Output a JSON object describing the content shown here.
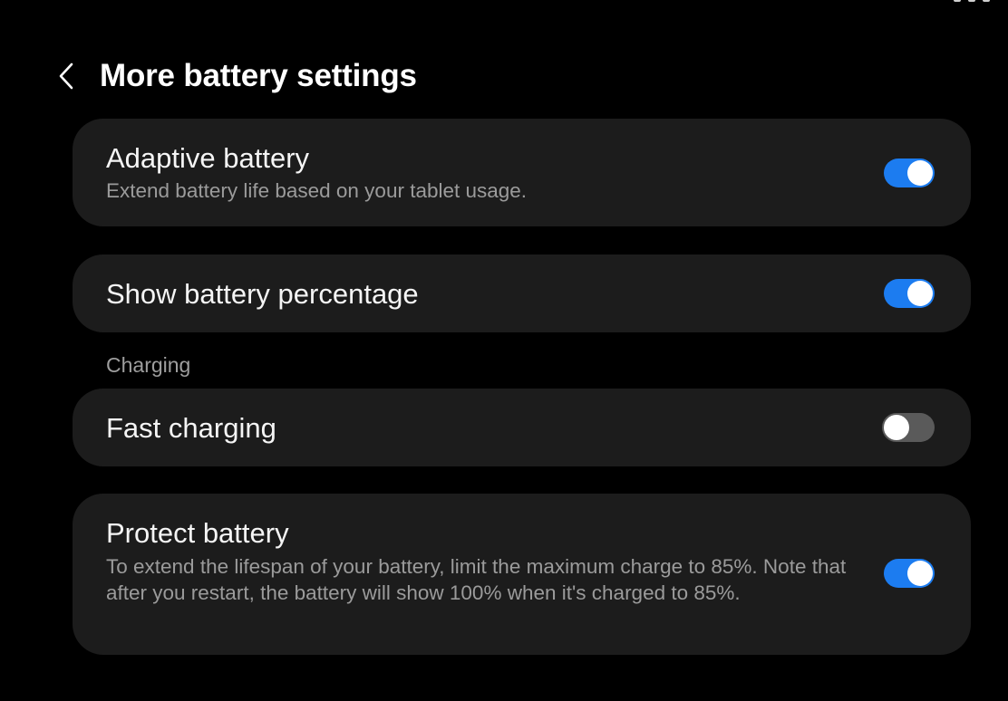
{
  "header": {
    "title": "More battery settings",
    "back_icon": "chevron-left-icon"
  },
  "settings": {
    "adaptive_battery": {
      "title": "Adaptive battery",
      "description": "Extend battery life based on your tablet usage.",
      "enabled": true
    },
    "show_battery_percentage": {
      "title": "Show battery percentage",
      "enabled": true
    },
    "charging_section_label": "Charging",
    "fast_charging": {
      "title": "Fast charging",
      "enabled": false
    },
    "protect_battery": {
      "title": "Protect battery",
      "description": "To extend the lifespan of your battery, limit the maximum charge to 85%. Note that after you restart, the battery will show 100% when it's charged to 85%.",
      "enabled": true
    }
  },
  "colors": {
    "background": "#000000",
    "card": "#1c1c1c",
    "toggle_on": "#1c7cf0",
    "toggle_off": "#5a5a5a"
  }
}
